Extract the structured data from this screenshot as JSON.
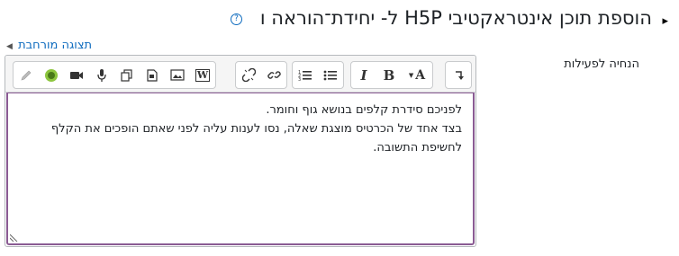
{
  "header": {
    "title": "הוספת תוכן אינטראקטיבי H5P ל- יחידת־הוראה ו",
    "help_glyph": "?",
    "cursor_glyph": "▸"
  },
  "expand_link": {
    "label": "תצוגה מורחבת"
  },
  "field": {
    "label": "הנחיה לפעילות"
  },
  "toolbar": {
    "groups": [
      [
        "direction-icon"
      ],
      [
        "font-color-icon",
        "bold-icon",
        "italic-icon"
      ],
      [
        "unordered-list-icon",
        "ordered-list-icon"
      ],
      [
        "link-icon",
        "unlink-icon"
      ],
      [
        "word-import-icon",
        "image-icon",
        "media-icon",
        "manage-files-icon",
        "record-audio-icon",
        "record-video-icon",
        "h5p-icon",
        "edit-icon"
      ]
    ],
    "font_color_letter": "A",
    "bold_letter": "B",
    "italic_letter": "I",
    "word_letter": "W"
  },
  "editor": {
    "lines": [
      "לפניכם סידרת קלפים בנושא גוף וחומר.",
      "בצד אחד של הכרטיס מוצגת שאלה, נסו לענות עליה לפני שאתם הופכים את הקלף לחשיפת התשובה."
    ]
  },
  "colors": {
    "accent": "#0f6cbf",
    "focus_border": "#8a5b93",
    "h5p_green": "#8dc63f"
  }
}
